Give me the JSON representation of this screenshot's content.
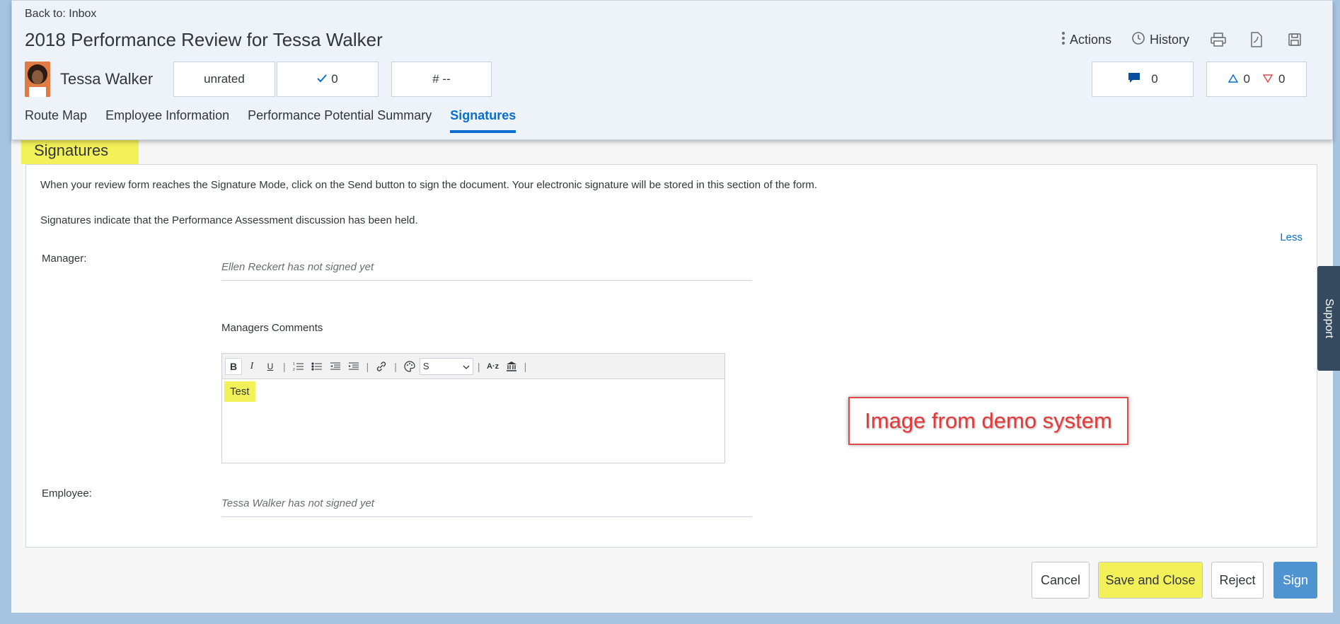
{
  "header": {
    "back_label": "Back to: Inbox",
    "title": "2018 Performance Review for Tessa Walker",
    "actions_label": "Actions",
    "history_label": "History",
    "employee_name": "Tessa Walker",
    "rating_label": "unrated",
    "checks_count": "0",
    "hash_value": "# --",
    "comments_count": "0",
    "up_count": "0",
    "down_count": "0"
  },
  "tabs": [
    {
      "label": "Route Map"
    },
    {
      "label": "Employee Information"
    },
    {
      "label": "Performance Potential Summary"
    },
    {
      "label": "Signatures",
      "active": true
    }
  ],
  "section": {
    "title": "Signatures",
    "intro_1": "When your review form reaches the Signature Mode, click on the Send button to sign the document. Your electronic signature will be stored in this section of the form.",
    "intro_2": "Signatures indicate that the Performance Assessment discussion has been held.",
    "less_link": "Less",
    "manager_label": "Manager:",
    "manager_status": "Ellen Reckert has not signed yet",
    "comments_label": "Managers Comments",
    "comment_text": "Test",
    "font_size_value": "S",
    "employee_label": "Employee:",
    "employee_status": "Tessa Walker has not signed yet"
  },
  "annotation": "Image from demo system",
  "support_label": "Support",
  "buttons": {
    "cancel": "Cancel",
    "save_close": "Save and Close",
    "reject": "Reject",
    "sign": "Sign"
  },
  "colors": {
    "accent": "#0a6ed1",
    "highlight": "#f3f159",
    "sign_button": "#4f93d1",
    "annotation_red": "#e33b3b"
  }
}
